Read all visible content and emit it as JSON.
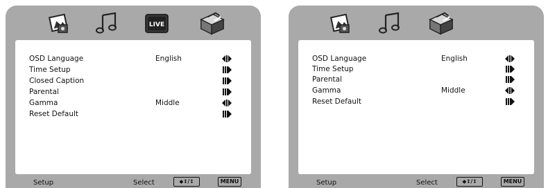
{
  "screens": [
    {
      "tabs": [
        {
          "icon": "picture-icon"
        },
        {
          "icon": "music-note-icon"
        },
        {
          "icon": "live-tv-icon",
          "label": "LIVE"
        },
        {
          "icon": "setup-toolbox-icon",
          "active": true
        }
      ],
      "items": [
        {
          "label": "OSD Language",
          "value": "English",
          "arrow": "left-right-arrow-icon"
        },
        {
          "label": "Time Setup",
          "value": "",
          "arrow": "right-arrow-icon"
        },
        {
          "label": "Closed Caption",
          "value": "",
          "arrow": "right-arrow-icon"
        },
        {
          "label": "Parental",
          "value": "",
          "arrow": "right-arrow-icon"
        },
        {
          "label": "Gamma",
          "value": "Middle",
          "arrow": "left-right-arrow-icon"
        },
        {
          "label": "Reset Default",
          "value": "",
          "arrow": "right-arrow-icon"
        }
      ],
      "footer": {
        "menu_name": "Setup",
        "select_label": "Select",
        "nav_key": "◆↕/↕",
        "menu_key": "MENU"
      }
    },
    {
      "tabs": [
        {
          "icon": "picture-icon"
        },
        {
          "icon": "music-note-icon"
        },
        {
          "icon": "setup-toolbox-icon",
          "active": true
        }
      ],
      "items": [
        {
          "label": "OSD Language",
          "value": "English",
          "arrow": "left-right-arrow-icon"
        },
        {
          "label": "Time Setup",
          "value": "",
          "arrow": "right-arrow-icon"
        },
        {
          "label": "Parental",
          "value": "",
          "arrow": "right-arrow-icon"
        },
        {
          "label": "Gamma",
          "value": "Middle",
          "arrow": "left-right-arrow-icon"
        },
        {
          "label": "Reset Default",
          "value": "",
          "arrow": "right-arrow-icon"
        }
      ],
      "footer": {
        "menu_name": "Setup",
        "select_label": "Select",
        "nav_key": "◆↕/↕",
        "menu_key": "MENU"
      }
    }
  ],
  "colors": {
    "panel": "#a9a9a9",
    "content": "#ffffff",
    "text": "#111111"
  }
}
